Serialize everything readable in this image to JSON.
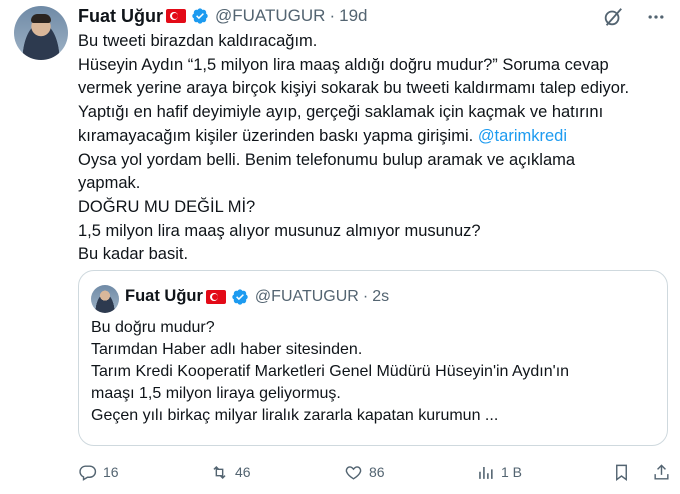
{
  "author": {
    "name": "Fuat Uğur",
    "handle": "@FUATUGUR",
    "separator": "·",
    "time": "19d"
  },
  "tweet_lines": [
    "Bu tweeti birazdan kaldıracağım.",
    "Hüseyin Aydın “1,5 milyon lira maaş aldığı doğru mudur?”  Soruma cevap",
    "vermek yerine araya birçok kişiyi sokarak bu tweeti kaldırmamı talep ediyor.",
    "Yaptığı en hafif deyimiyle ayıp, gerçeği saklamak için kaçmak ve hatırını",
    "kıramayacağım kişiler üzerinden baskı yapma girişimi.",
    "Oysa yol yordam belli. Benim telefonumu bulup aramak ve açıklama",
    "yapmak.",
    "DOĞRU MU DEĞİL Mİ?",
    "1,5 milyon lira maaş alıyor musunuz almıyor musunuz?",
    "Bu kadar basit."
  ],
  "mention": "@tarimkredi",
  "quoted": {
    "name": "Fuat Uğur",
    "handle": "@FUATUGUR",
    "separator": "·",
    "time": "2s",
    "lines": [
      "Bu doğru mudur?",
      "Tarımdan Haber adlı haber sitesinden.",
      "Tarım Kredi Kooperatif Marketleri Genel Müdürü Hüseyin'in Aydın'ın",
      "maaşı 1,5 milyon liraya geliyormuş.",
      "Geçen yılı birkaç milyar liralık zararla kapatan kurumun ..."
    ]
  },
  "actions": {
    "replies": "16",
    "reposts": "46",
    "likes": "86",
    "views": "1 B"
  },
  "icons": {
    "verified": "verified-badge-icon",
    "flag": "turkey-flag-icon",
    "grok": "grok-icon",
    "more": "more-icon",
    "reply": "reply-icon",
    "repost": "repost-icon",
    "like": "like-icon",
    "views": "views-icon",
    "bookmark": "bookmark-icon",
    "share": "share-icon"
  },
  "colors": {
    "accent": "#1d9bf0",
    "text": "#0f1419",
    "muted": "#536471",
    "border": "#cfd9de"
  }
}
